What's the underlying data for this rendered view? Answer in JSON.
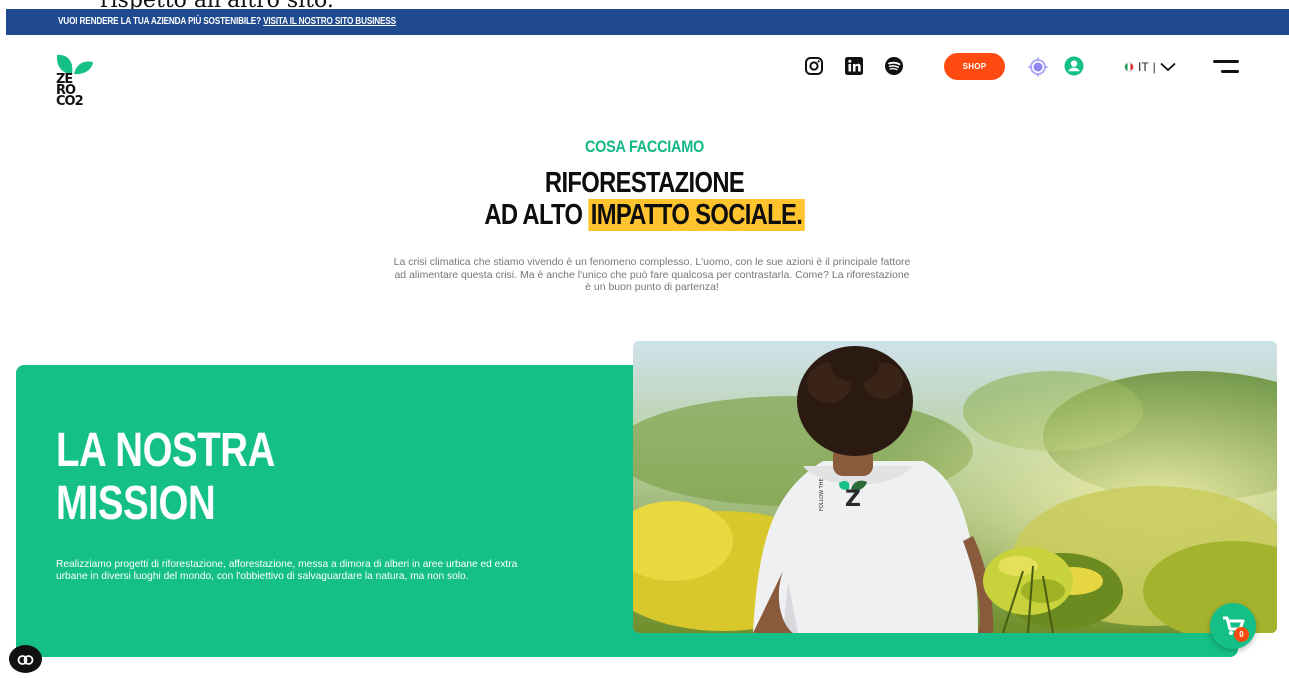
{
  "clipped_text": "rispetto all'altro sito.",
  "topbar": {
    "message": "VUOI RENDERE LA TUA AZIENDA PIÙ SOSTENIBILE?",
    "link": "VISITA IL NOSTRO SITO BUSINESS",
    "color": "#1f4a8f"
  },
  "logo": {
    "lines": [
      "ZE",
      "RO",
      "CO2"
    ]
  },
  "header": {
    "social": [
      "instagram-icon",
      "linkedin-icon",
      "spotify-icon"
    ],
    "shop_label": "SHOP",
    "language": "IT",
    "accent": "#ff4a12"
  },
  "hero": {
    "eyebrow": "COSA FACCIAMO",
    "title_line1": "RIFORESTAZIONE",
    "title_line2_prefix": "AD ALTO",
    "title_line2_highlight": "IMPATTO SOCIALE.",
    "intro": "La crisi climatica che stiamo vivendo è un fenomeno complesso. L'uomo, con le sue azioni è il principale fattore ad alimentare questa crisi. Ma è anche l'unico che può fare qualcosa per contrastarla. Come? La riforestazione è un buon punto di partenza!",
    "green": "#12b886",
    "highlight": "#ffc42e"
  },
  "mission": {
    "title_line1": "LA NOSTRA",
    "title_line2": "MISSION",
    "text": "Realizziamo progetti di riforestazione, afforestazione, messa a dimora di alberi in aree urbane ed extra urbane in diversi luoghi del mondo, con l'obbiettivo di salvaguardare la natura, ma non solo.",
    "tshirt_print": "FOLLOW THE",
    "color": "#14c088"
  },
  "cart": {
    "count": "0"
  }
}
